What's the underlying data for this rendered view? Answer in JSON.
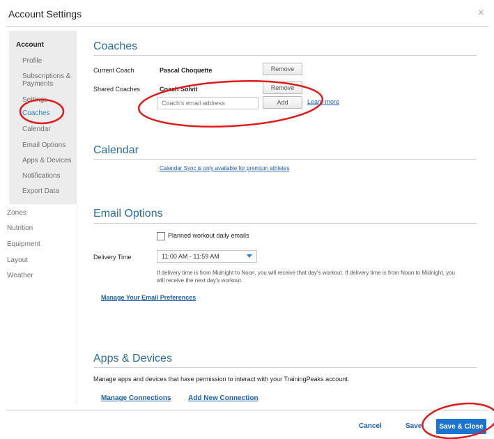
{
  "window": {
    "title": "Account Settings",
    "close_glyph": "×"
  },
  "sidebar": {
    "account_group": {
      "heading": "Account",
      "items": [
        {
          "label": "Profile"
        },
        {
          "label": "Subscriptions &"
        },
        {
          "label": "Payments"
        },
        {
          "label": "Settings"
        },
        {
          "label": "Coaches",
          "active": true
        },
        {
          "label": "Calendar"
        },
        {
          "label": "Email Options"
        },
        {
          "label": "Apps & Devices"
        },
        {
          "label": "Notifications"
        },
        {
          "label": "Export Data"
        }
      ]
    },
    "other_items": [
      {
        "label": "Zones"
      },
      {
        "label": "Nutrition"
      },
      {
        "label": "Equipment"
      },
      {
        "label": "Layout"
      },
      {
        "label": "Weather"
      }
    ]
  },
  "coaches": {
    "title": "Coaches",
    "current_label": "Current Coach",
    "current_name": "Pascal Choquette",
    "remove_label": "Remove",
    "shared_label": "Shared Coaches",
    "shared_name": "Coach Solvit",
    "email_placeholder": "Coach's email address",
    "add_label": "Add",
    "learn_more": "Learn more"
  },
  "calendar": {
    "title": "Calendar",
    "sync_link": "Calendar Sync is only available for premium athletes"
  },
  "email_options": {
    "title": "Email Options",
    "daily_emails_label": "Planned workout daily emails",
    "daily_emails_checked": false,
    "delivery_label": "Delivery Time",
    "delivery_value": "11:00 AM - 11:59 AM",
    "note_line1": "If delivery time is from Midnight to Noon, you will receive that day's workout. If delivery time is from Noon to Midnight, you",
    "note_line2": "will receive the next day's workout.",
    "manage_link": "Manage Your Email Preferences"
  },
  "apps_devices": {
    "title": "Apps & Devices",
    "description": "Manage apps and devices that have permission to interact with your TrainingPeaks account.",
    "manage_link": "Manage Connections",
    "add_link": "Add New Connection"
  },
  "footer": {
    "cancel_label": "Cancel",
    "save_label": "Save",
    "save_close_label": "Save & Close"
  },
  "colors": {
    "accent": "#1d74d0",
    "link": "#1f5fae",
    "annotation": "#e01b1b",
    "section_title": "#2b6e9e"
  }
}
